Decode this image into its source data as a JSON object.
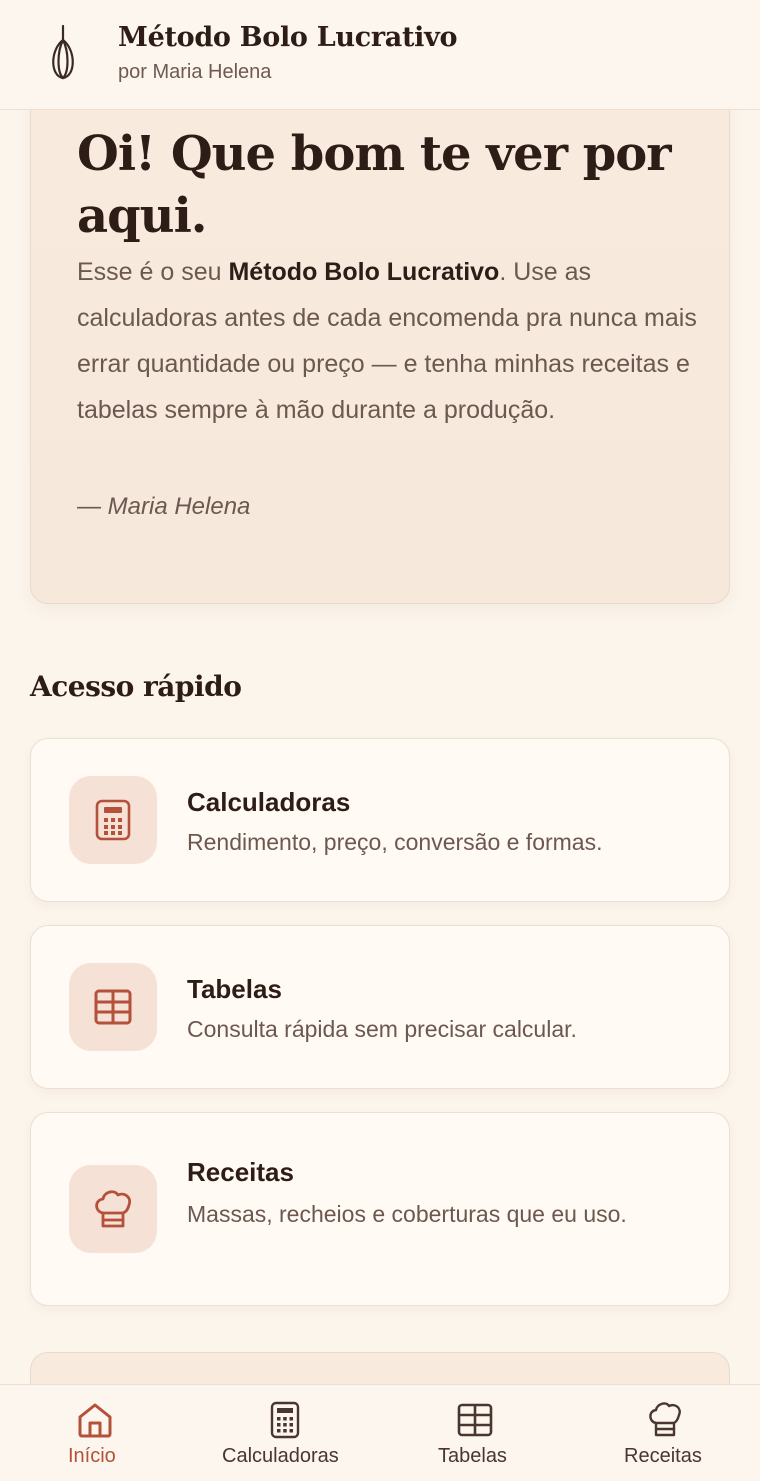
{
  "colors": {
    "accent": "#b4513a",
    "background": "#fcf5ec",
    "icon_bg": "#f5e1d6",
    "text_dark": "#2e1d17",
    "text_muted": "#6c5850"
  },
  "header": {
    "title": "Método Bolo Lucrativo",
    "subtitle": "por Maria Helena",
    "logo_icon": "whisk-icon"
  },
  "hero": {
    "greeting": "Oi! Que bom te ver por aqui.",
    "intro_prefix": "Esse é o seu ",
    "intro_bold": "Método Bolo Lucrativo",
    "intro_suffix": ". Use as calculadoras antes de cada encomenda pra nunca mais errar quantidade ou preço — e tenha minhas receitas e tabelas sempre à mão durante a produção.",
    "signature": "— Maria Helena"
  },
  "quick_access": {
    "title": "Acesso rápido",
    "cards": [
      {
        "title": "Calculadoras",
        "description": "Rendimento, preço, conversão e formas.",
        "icon": "calculator-icon"
      },
      {
        "title": "Tabelas",
        "description": "Consulta rápida sem precisar calcular.",
        "icon": "table-icon"
      },
      {
        "title": "Receitas",
        "description": "Massas, recheios e coberturas que eu uso.",
        "icon": "chef-hat-icon"
      }
    ]
  },
  "bottom_nav": {
    "items": [
      {
        "label": "Início",
        "icon": "home-icon",
        "active": true
      },
      {
        "label": "Calculadoras",
        "icon": "calculator-icon",
        "active": false
      },
      {
        "label": "Tabelas",
        "icon": "table-icon",
        "active": false
      },
      {
        "label": "Receitas",
        "icon": "chef-hat-icon",
        "active": false
      }
    ]
  }
}
